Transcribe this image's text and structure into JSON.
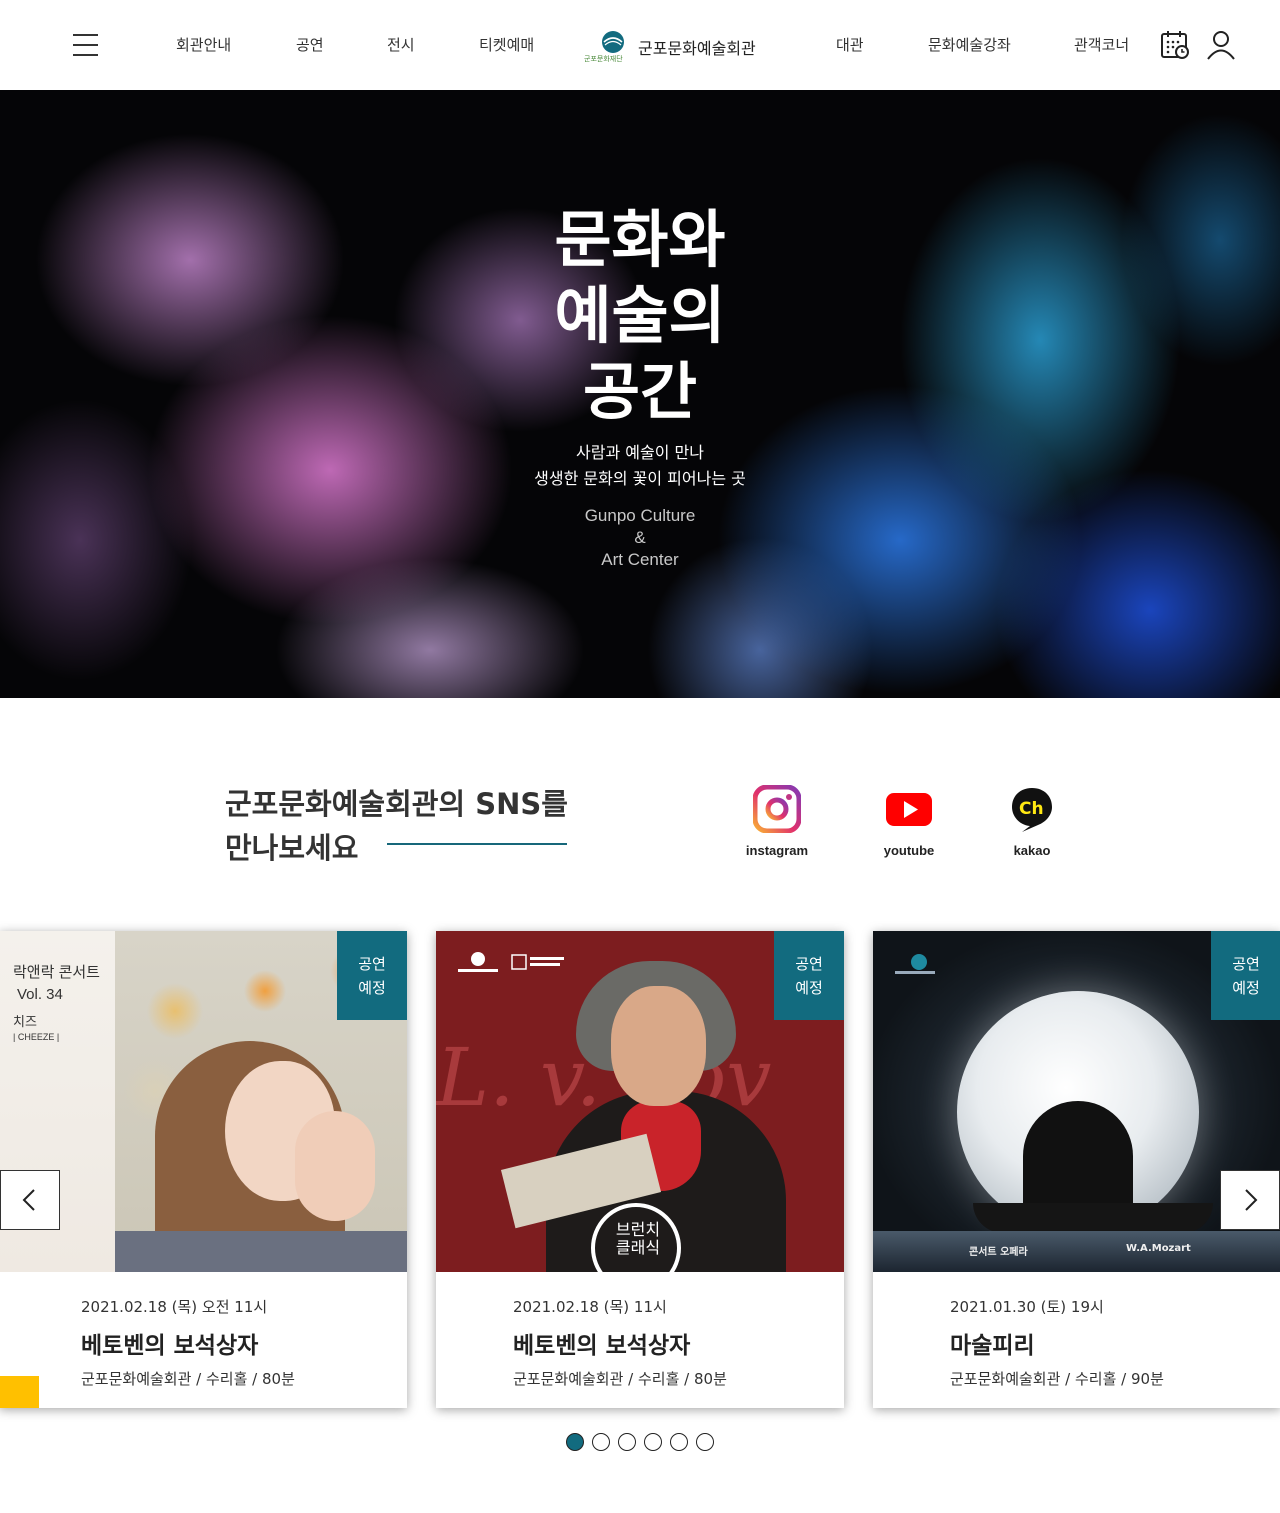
{
  "header": {
    "menu_icon": "hamburger-menu-icon",
    "nav_left": [
      "회관안내",
      "공연",
      "전시",
      "티켓예매"
    ],
    "logo_name": "군포문화예술회관",
    "logo_mark_text": "군포문화재단",
    "nav_right": [
      "대관",
      "문화예술강좌",
      "관객코너"
    ],
    "icons": [
      "calendar-icon",
      "user-icon"
    ]
  },
  "hero": {
    "title_lines": [
      "문화와",
      "예술의",
      "공간"
    ],
    "subtitle_lines": [
      "사람과 예술이 만나",
      "생생한 문화의 꽃이 피어나는 곳"
    ],
    "english_lines": [
      "Gunpo Culture",
      "&",
      "Art Center"
    ]
  },
  "sns": {
    "title_lines": [
      "군포문화예술회관의 SNS를",
      "만나보세요"
    ],
    "items": [
      {
        "label": "instagram",
        "icon": "instagram-icon",
        "color": "#c13584"
      },
      {
        "label": "youtube",
        "icon": "youtube-icon",
        "color": "#ff0000"
      },
      {
        "label": "kakao",
        "icon": "kakao-channel-icon",
        "color": "#ffe812"
      }
    ]
  },
  "cards": [
    {
      "badge_lines": [
        "공연",
        "예정"
      ],
      "poster_lines": [
        "락앤락 콘서트",
        "Vol. 34",
        "치즈",
        "| CHEEZE |"
      ],
      "date": "2021.02.18 (목) 오전 11시",
      "title": "베토벤의 보석상자",
      "place": "군포문화예술회관 / 수리홀 / 80분"
    },
    {
      "badge_lines": [
        "공연",
        "예정"
      ],
      "poster_lines": [
        "브런치",
        "클래식"
      ],
      "date": "2021.02.18 (목) 11시",
      "title": "베토벤의 보석상자",
      "place": "군포문화예술회관 / 수리홀 / 80분"
    },
    {
      "badge_lines": [
        "공연",
        "예정"
      ],
      "poster_lines": [
        "콘서트 오페라",
        "W.A.Mozart"
      ],
      "date": "2021.01.30 (토) 19시",
      "title": "마술피리",
      "place": "군포문화예술회관 / 수리홀 / 90분"
    }
  ],
  "carousel": {
    "prev_icon": "chevron-left-icon",
    "next_icon": "chevron-right-icon",
    "page_count": 6,
    "active_page": 1
  },
  "colors": {
    "accent": "#126b7f",
    "badge": "#126b7f"
  }
}
